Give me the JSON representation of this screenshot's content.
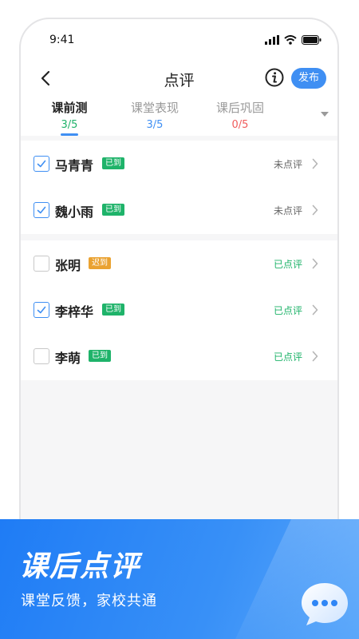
{
  "status_bar": {
    "time": "9:41"
  },
  "nav": {
    "title": "点评",
    "publish_label": "发布"
  },
  "tabs": [
    {
      "label": "课前测",
      "count": "3/5",
      "count_color": "#1fb36a"
    },
    {
      "label": "课堂表现",
      "count": "3/5",
      "count_color": "#3f8ff3"
    },
    {
      "label": "课后巩固",
      "count": "0/5",
      "count_color": "#f05b5b"
    }
  ],
  "students": [
    {
      "name": "马青青",
      "attendance": "已到",
      "review": "未点评",
      "checked": true
    },
    {
      "name": "魏小雨",
      "attendance": "已到",
      "review": "未点评",
      "checked": true
    },
    {
      "name": "张明",
      "attendance": "迟到",
      "review": "已点评",
      "checked": false
    },
    {
      "name": "李梓华",
      "attendance": "已到",
      "review": "已点评",
      "checked": true
    },
    {
      "name": "李萌",
      "attendance": "已到",
      "review": "已点评",
      "checked": false
    }
  ],
  "colors": {
    "accent": "#3f8ff3",
    "present": "#1fb36a",
    "late": "#eaa231",
    "reviewed": "#1fb36a",
    "not_reviewed": "#666666"
  },
  "banner": {
    "headline": "课后点评",
    "subtitle": "课堂反馈，家校共通"
  }
}
